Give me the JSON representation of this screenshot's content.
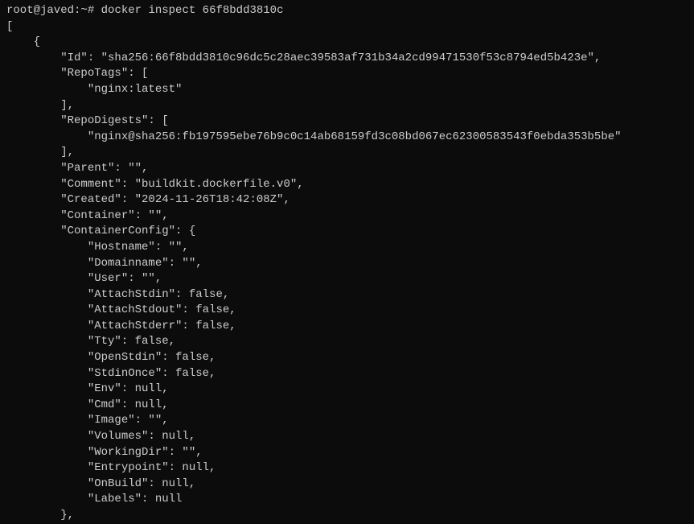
{
  "prompt": {
    "user_host": "root@javed",
    "separator": ":",
    "path": "~",
    "symbol": "#",
    "command": "docker inspect 66f8bdd3810c"
  },
  "output": {
    "lines": [
      "[",
      "    {",
      "        \"Id\": \"sha256:66f8bdd3810c96dc5c28aec39583af731b34a2cd99471530f53c8794ed5b423e\",",
      "        \"RepoTags\": [",
      "            \"nginx:latest\"",
      "        ],",
      "        \"RepoDigests\": [",
      "            \"nginx@sha256:fb197595ebe76b9c0c14ab68159fd3c08bd067ec62300583543f0ebda353b5be\"",
      "        ],",
      "        \"Parent\": \"\",",
      "        \"Comment\": \"buildkit.dockerfile.v0\",",
      "        \"Created\": \"2024-11-26T18:42:08Z\",",
      "        \"Container\": \"\",",
      "        \"ContainerConfig\": {",
      "            \"Hostname\": \"\",",
      "            \"Domainname\": \"\",",
      "            \"User\": \"\",",
      "            \"AttachStdin\": false,",
      "            \"AttachStdout\": false,",
      "            \"AttachStderr\": false,",
      "            \"Tty\": false,",
      "            \"OpenStdin\": false,",
      "            \"StdinOnce\": false,",
      "            \"Env\": null,",
      "            \"Cmd\": null,",
      "            \"Image\": \"\",",
      "            \"Volumes\": null,",
      "            \"WorkingDir\": \"\",",
      "            \"Entrypoint\": null,",
      "            \"OnBuild\": null,",
      "            \"Labels\": null",
      "        },"
    ]
  }
}
